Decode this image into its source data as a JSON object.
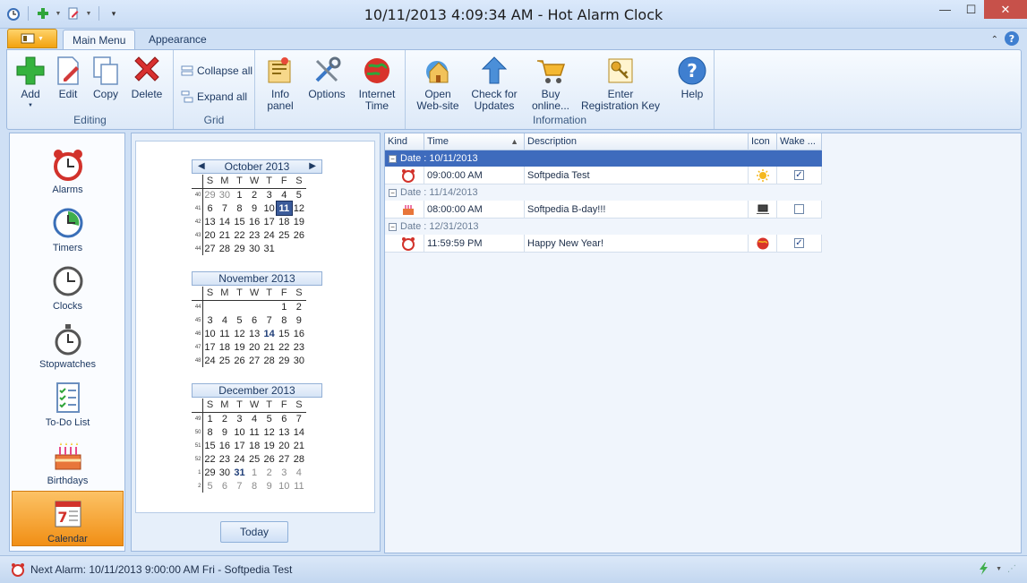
{
  "window": {
    "title": "10/11/2013 4:09:34 AM - Hot Alarm Clock",
    "minimize": "—",
    "maximize": "☐",
    "close": "✕"
  },
  "tabs": {
    "main": "Main Menu",
    "appearance": "Appearance"
  },
  "ribbon": {
    "editing": {
      "label": "Editing",
      "add": "Add",
      "edit": "Edit",
      "copy": "Copy",
      "delete": "Delete"
    },
    "grid": {
      "label": "Grid",
      "collapse": "Collapse all",
      "expand": "Expand all"
    },
    "info_panel": "Info\npanel",
    "options": "Options",
    "internet_time": "Internet\nTime",
    "information": {
      "label": "Information",
      "open_site": "Open\nWeb-site",
      "check_updates": "Check for\nUpdates",
      "buy": "Buy\nonline...",
      "enter_key": "Enter\nRegistration Key"
    },
    "help": "Help"
  },
  "nav": [
    "Alarms",
    "Timers",
    "Clocks",
    "Stopwatches",
    "To-Do List",
    "Birthdays",
    "Calendar"
  ],
  "calendar": {
    "dow": [
      "S",
      "M",
      "T",
      "W",
      "T",
      "F",
      "S"
    ],
    "today_label": "Today",
    "months": [
      {
        "title": "October 2013",
        "weeks": [
          {
            "wk": "40",
            "days": [
              "29",
              "30",
              "1",
              "2",
              "3",
              "4",
              "5"
            ]
          },
          {
            "wk": "41",
            "days": [
              "6",
              "7",
              "8",
              "9",
              "10",
              "11",
              "12"
            ]
          },
          {
            "wk": "42",
            "days": [
              "13",
              "14",
              "15",
              "16",
              "17",
              "18",
              "19"
            ]
          },
          {
            "wk": "43",
            "days": [
              "20",
              "21",
              "22",
              "23",
              "24",
              "25",
              "26"
            ]
          },
          {
            "wk": "44",
            "days": [
              "27",
              "28",
              "29",
              "30",
              "31",
              "",
              ""
            ]
          }
        ]
      },
      {
        "title": "November 2013",
        "weeks": [
          {
            "wk": "44",
            "days": [
              "",
              "",
              "",
              "",
              "",
              "1",
              "2"
            ]
          },
          {
            "wk": "45",
            "days": [
              "3",
              "4",
              "5",
              "6",
              "7",
              "8",
              "9"
            ]
          },
          {
            "wk": "46",
            "days": [
              "10",
              "11",
              "12",
              "13",
              "14",
              "15",
              "16"
            ]
          },
          {
            "wk": "47",
            "days": [
              "17",
              "18",
              "19",
              "20",
              "21",
              "22",
              "23"
            ]
          },
          {
            "wk": "48",
            "days": [
              "24",
              "25",
              "26",
              "27",
              "28",
              "29",
              "30"
            ]
          }
        ]
      },
      {
        "title": "December 2013",
        "weeks": [
          {
            "wk": "49",
            "days": [
              "1",
              "2",
              "3",
              "4",
              "5",
              "6",
              "7"
            ]
          },
          {
            "wk": "50",
            "days": [
              "8",
              "9",
              "10",
              "11",
              "12",
              "13",
              "14"
            ]
          },
          {
            "wk": "51",
            "days": [
              "15",
              "16",
              "17",
              "18",
              "19",
              "20",
              "21"
            ]
          },
          {
            "wk": "52",
            "days": [
              "22",
              "23",
              "24",
              "25",
              "26",
              "27",
              "28"
            ]
          },
          {
            "wk": "1",
            "days": [
              "29",
              "30",
              "31",
              "1",
              "2",
              "3",
              "4"
            ]
          },
          {
            "wk": "2",
            "days": [
              "5",
              "6",
              "7",
              "8",
              "9",
              "10",
              "11"
            ]
          }
        ]
      }
    ]
  },
  "grid": {
    "columns": [
      "Kind",
      "Time",
      "Description",
      "Icon",
      "Wake ..."
    ],
    "groups": [
      {
        "label": "Date : 10/11/2013",
        "rows": [
          {
            "time": "09:00:00 AM",
            "description": "Softpedia Test",
            "wake": true
          }
        ]
      },
      {
        "label": "Date : 11/14/2013",
        "rows": [
          {
            "time": "08:00:00 AM",
            "description": "Softpedia B-day!!!",
            "wake": false
          }
        ]
      },
      {
        "label": "Date : 12/31/2013",
        "rows": [
          {
            "time": "11:59:59 PM",
            "description": "Happy New Year!",
            "wake": true
          }
        ]
      }
    ]
  },
  "status": {
    "next_alarm": "Next Alarm: 10/11/2013 9:00:00 AM Fri - Softpedia Test"
  }
}
